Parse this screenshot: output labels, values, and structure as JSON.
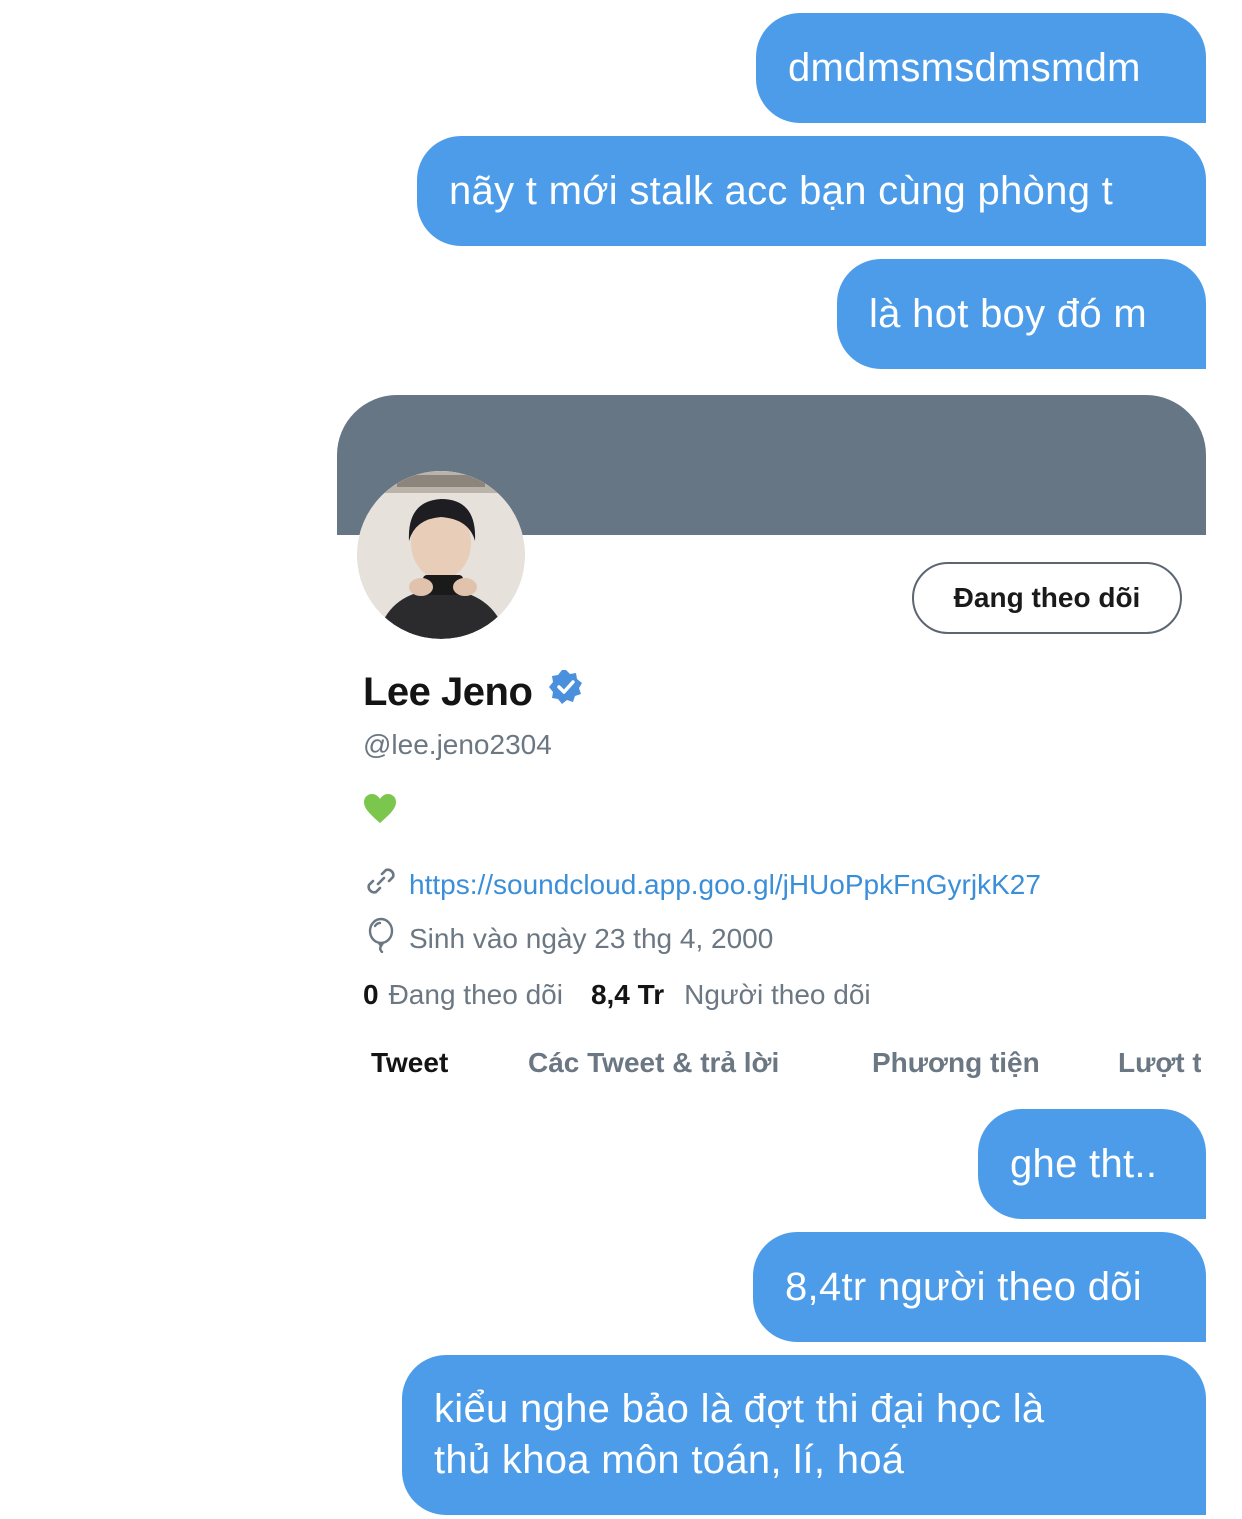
{
  "messages_top": [
    "dmdmsmsdmsmdm",
    "nãy t mới stalk acc bạn cùng phòng t",
    "là hot boy đó m"
  ],
  "profile": {
    "follow_button": "Đang theo dõi",
    "name": "Lee Jeno",
    "verified_icon": "verified-badge-icon",
    "handle": "@lee.jeno2304",
    "bio": "💚",
    "link_icon": "link-icon",
    "link": "https://soundcloud.app.goo.gl/jHUoPpkFnGyrjkK27",
    "birthday_icon": "balloon-icon",
    "birthday": "Sinh vào ngày 23 thg 4, 2000",
    "following_count": "0",
    "following_label": "Đang theo dõi",
    "followers_count": "8,4 Tr",
    "followers_label": "Người theo dõi",
    "tabs": [
      "Tweet",
      "Các Tweet & trả lời",
      "Phương tiện",
      "Lượt t"
    ],
    "banner_color": "#677684",
    "accent_color": "#4c9ce9"
  },
  "messages_bottom": [
    "ghe tht..",
    "8,4tr người theo dõi",
    "kiểu nghe bảo là đợt thi đại học là",
    "thủ khoa môn toán, lí, hoá"
  ]
}
